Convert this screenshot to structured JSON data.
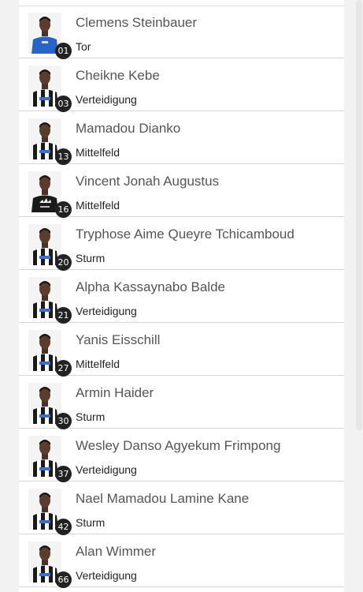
{
  "colors": {
    "kit_black": "#1a1a1a",
    "kit_white": "#ffffff",
    "keeper_blue": "#2a63c6",
    "badge": "#222222"
  },
  "players": [
    {
      "number": "01",
      "name": "Clemens Steinbauer",
      "position": "Tor",
      "kit": "keeper"
    },
    {
      "number": "03",
      "name": "Cheikne Kebe",
      "position": "Verteidigung",
      "kit": "stripes"
    },
    {
      "number": "13",
      "name": "Mamadou Dianko",
      "position": "Mittelfeld",
      "kit": "stripes"
    },
    {
      "number": "16",
      "name": "Vincent Jonah Augustus",
      "position": "Mittelfeld",
      "kit": "training"
    },
    {
      "number": "20",
      "name": "Tryphose Aime Queyre Tchicamboud",
      "position": "Sturm",
      "kit": "stripes"
    },
    {
      "number": "21",
      "name": "Alpha Kassaynabo Balde",
      "position": "Verteidigung",
      "kit": "stripes"
    },
    {
      "number": "27",
      "name": "Yanis Eisschill",
      "position": "Mittelfeld",
      "kit": "stripes"
    },
    {
      "number": "30",
      "name": "Armin Haider",
      "position": "Sturm",
      "kit": "stripes"
    },
    {
      "number": "37",
      "name": "Wesley Danso Agyekum Frimpong",
      "position": "Verteidigung",
      "kit": "stripes"
    },
    {
      "number": "42",
      "name": "Nael Mamadou Lamine Kane",
      "position": "Sturm",
      "kit": "stripes"
    },
    {
      "number": "66",
      "name": "Alan Wimmer",
      "position": "Verteidigung",
      "kit": "stripes"
    }
  ]
}
